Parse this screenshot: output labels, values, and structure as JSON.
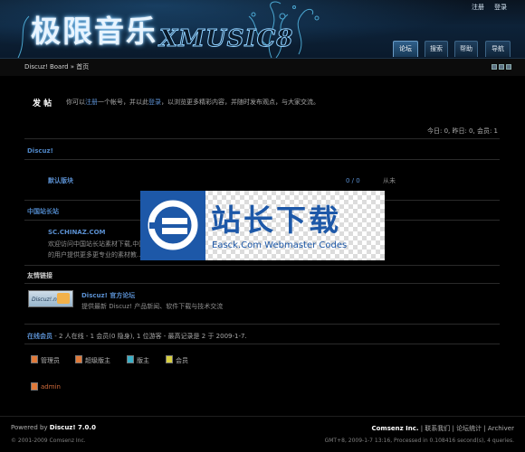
{
  "header": {
    "logo_cn": "极限音乐",
    "logo_en": "XMUSIC8",
    "top_links": [
      "注册",
      "登录"
    ],
    "nav": [
      "论坛",
      "搜索",
      "帮助",
      "导航"
    ],
    "active_nav": "论坛"
  },
  "breadcrumb": "Discuz! Board » 首页",
  "pm": {
    "title": "发 帖",
    "text_before": "你可以",
    "register_link": "注册",
    "text_mid": "一个帐号，并以此",
    "login_link": "登录",
    "text_after": "，以浏览更多精彩内容，并随时发布观点，与大家交流。"
  },
  "stats": "今日: 0, 昨日: 0, 会员: 1",
  "categories": [
    {
      "title": "Discuz!",
      "forum_name": "默认版块",
      "posts": "0 / 0",
      "last_post": "从未"
    },
    {
      "title": "中国站长站",
      "forum_name": "SC.CHINAZ.COM",
      "desc_line1": "欢迎访问中国站长站素材下载,中国",
      "desc_line2": "的用户提供更多更专业的素材教..."
    }
  ],
  "friends": {
    "title": "友情链接",
    "logo_text": "Discuz!.net",
    "name": "Discuz! 官方论坛",
    "desc": "提供最新 Discuz! 产品新闻、软件下载与技术交流"
  },
  "online": {
    "label": "在线会员",
    "text": " - 2 人在线 - 1 会员(0 隐身), 1 位游客 - 最高记录是 2 于 2009-1-7."
  },
  "legend": [
    {
      "label": "管理员",
      "color": "#e07a3a"
    },
    {
      "label": "超级版主",
      "color": "#e07a3a"
    },
    {
      "label": "版主",
      "color": "#3ab0c8"
    },
    {
      "label": "会员",
      "color": "#d8d040"
    }
  ],
  "online_user": "admin",
  "footer": {
    "powered_prefix": "Powered by ",
    "product": "Discuz! 7.0.0",
    "copyright": "© 2001-2009 Comsenz Inc.",
    "company": "Comsenz Inc.",
    "links": " | 联系我们 | 论坛统计 | Archiver",
    "info": "GMT+8, 2009-1-7 13:16, Processed in 0.108416 second(s), 4 queries."
  },
  "watermark": {
    "cn": "站长下载",
    "en": "Easck.Com Webmaster Codes"
  },
  "colors": {
    "accent": "#5a8fd0",
    "watermark": "#1d58a8",
    "background": "#000000"
  }
}
